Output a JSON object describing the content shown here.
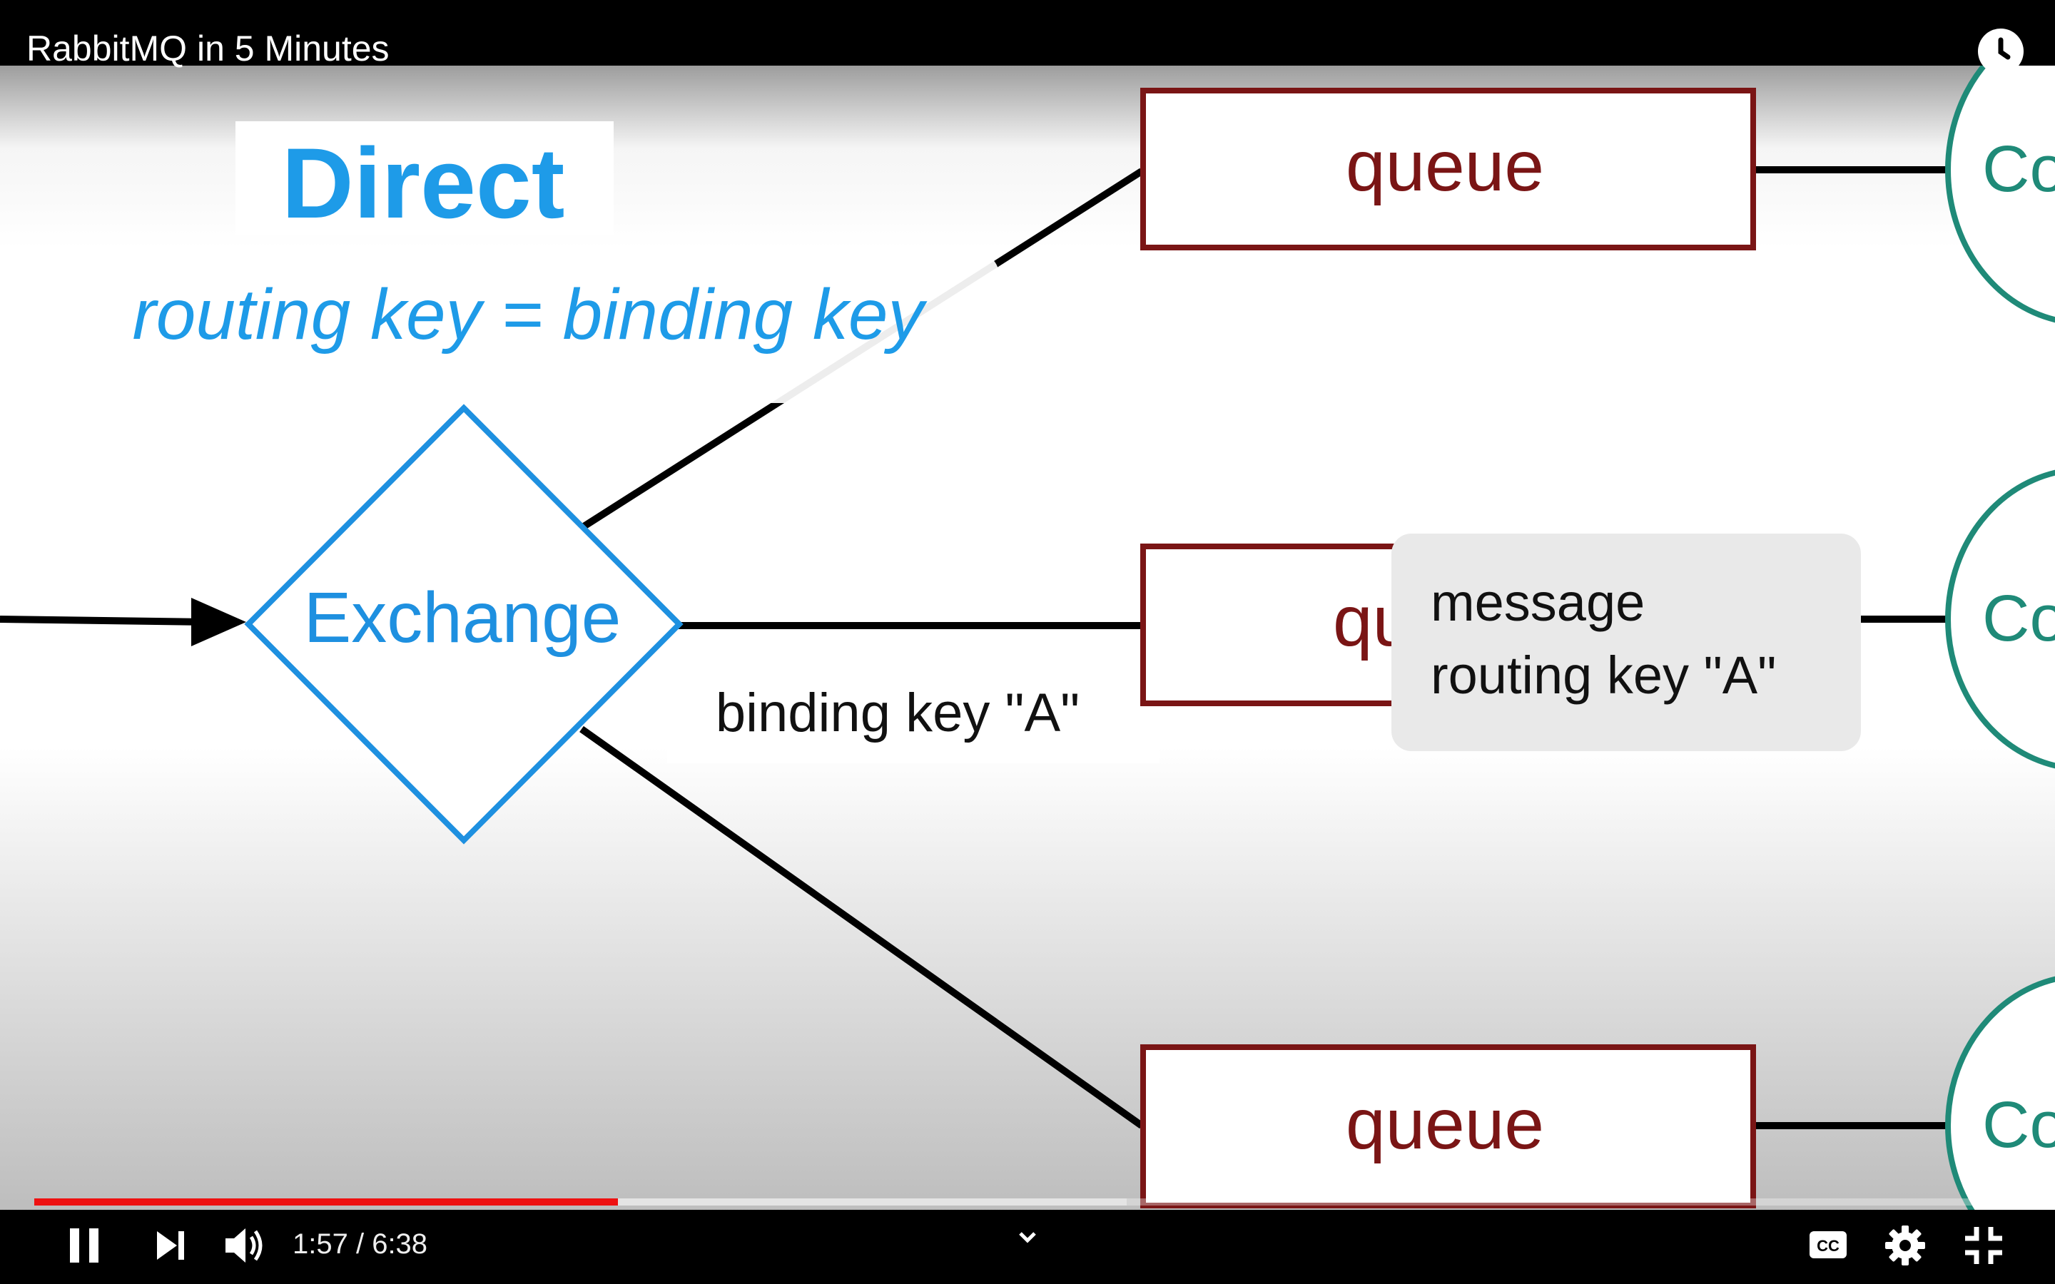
{
  "player": {
    "title": "RabbitMQ in 5 Minutes",
    "time_display": "1:57 / 6:38",
    "progress_played": 0.294,
    "progress_buffered": 0.55,
    "accent_color": "#ee1111"
  },
  "slide": {
    "heading": "Direct",
    "subheading": "routing key = binding key",
    "exchange_label": "Exchange",
    "queue_label": "queue",
    "queue_partial_label": "qu",
    "binding_key_label": "binding key \"A\"",
    "message_line1": "message",
    "message_line2": "routing key \"A\"",
    "consumer_partial_label": "Co",
    "colors": {
      "exchange": "#1e90e0",
      "queue": "#7a1515",
      "consumer": "#1f8a78",
      "heading": "#1e9be8"
    }
  },
  "icons": {
    "top": [
      "watch-later-icon"
    ],
    "controls": [
      "pause-icon",
      "next-icon",
      "volume-icon",
      "chevron-down-icon",
      "captions-icon",
      "gear-icon",
      "exit-fullscreen-icon"
    ]
  }
}
